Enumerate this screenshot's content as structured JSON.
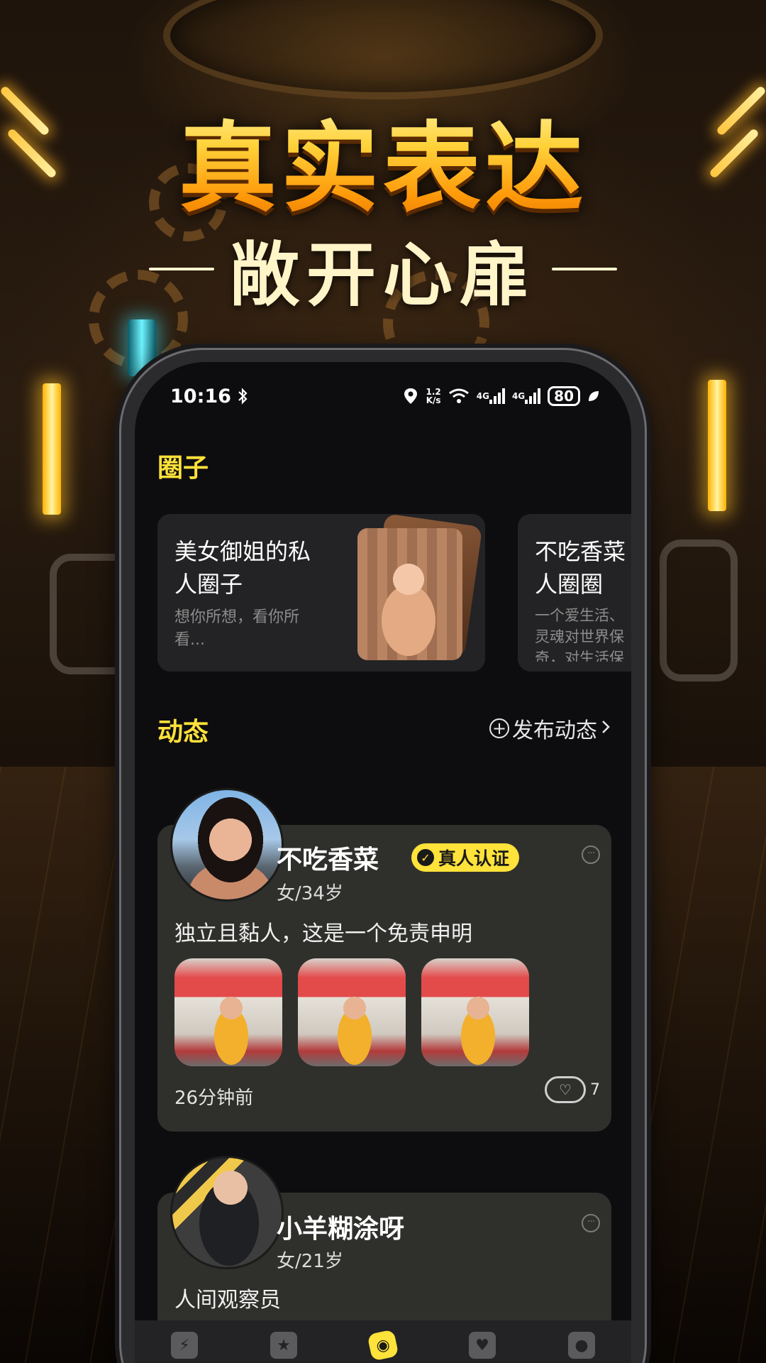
{
  "promo": {
    "headline": "真实表达",
    "subline": "敞开心扉"
  },
  "status_bar": {
    "time": "10:16",
    "speed_value": "1.2",
    "speed_unit": "K/s",
    "signal_1": "4G",
    "signal_2": "4G",
    "battery": "80"
  },
  "circles": {
    "title": "圈子",
    "items": [
      {
        "name": "美女御姐的私人圈子",
        "desc": "想你所想，看你所看..."
      },
      {
        "name": "不吃香菜人圈圈",
        "desc": "一个爱生活、灵魂对世界保奇，对生活保"
      }
    ]
  },
  "feed": {
    "title": "动态",
    "publish_label": "发布动态",
    "posts": [
      {
        "username": "不吃香菜",
        "badge": "真人认证",
        "meta": "女/34岁",
        "text": "独立且黏人，这是一个免责申明",
        "time": "26分钟前",
        "comments": "7"
      },
      {
        "username": "小羊糊涂呀",
        "meta": "女/21岁",
        "text": "人间观察员"
      }
    ]
  },
  "tabbar": {
    "icons": [
      "lightning-icon",
      "star-icon",
      "square-logo-icon",
      "heart-icon",
      "profile-icon"
    ],
    "active_index": 2
  },
  "colors": {
    "accent": "#ffe23a",
    "card_bg": "#2f302c",
    "screen_bg": "#0d0d0f",
    "headline_gold": "#ffb21a"
  }
}
